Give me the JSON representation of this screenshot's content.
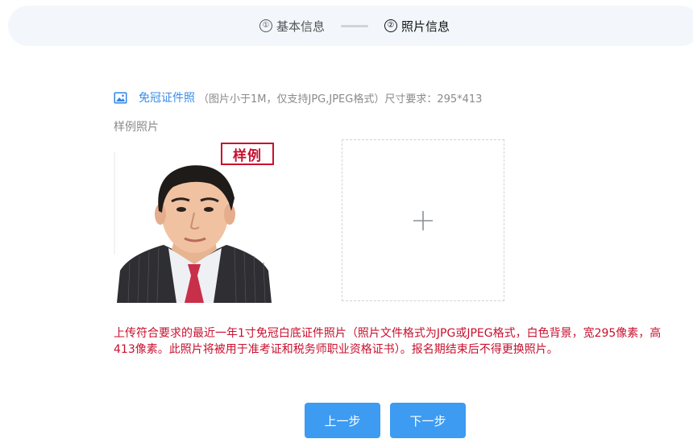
{
  "stepper": {
    "steps": [
      {
        "number": "①",
        "label": "基本信息",
        "state": "inactive"
      },
      {
        "number": "②",
        "label": "照片信息",
        "state": "active"
      }
    ]
  },
  "upload": {
    "title": "免冠证件照",
    "hint": "（图片小于1M，仅支持JPG,JPEG格式）尺寸要求：295*413",
    "sample_label": "样例照片",
    "sample_stamp": "样例",
    "notice": "上传符合要求的最近一年1寸免冠白底证件照片（照片文件格式为JPG或JPEG格式，白色背景，宽295像素，高413像素。此照片将被用于准考证和税务师职业资格证书）。报名期结束后不得更换照片。"
  },
  "buttons": {
    "prev_label": "上一步",
    "next_label": "下一步"
  },
  "colors": {
    "accent": "#3d9bf2",
    "link": "#3b8ce8",
    "warning": "#c8102e",
    "stepper_bg": "#f3f7fc"
  },
  "icons": {
    "title_icon": "image-icon",
    "upload_icon": "plus-icon"
  }
}
